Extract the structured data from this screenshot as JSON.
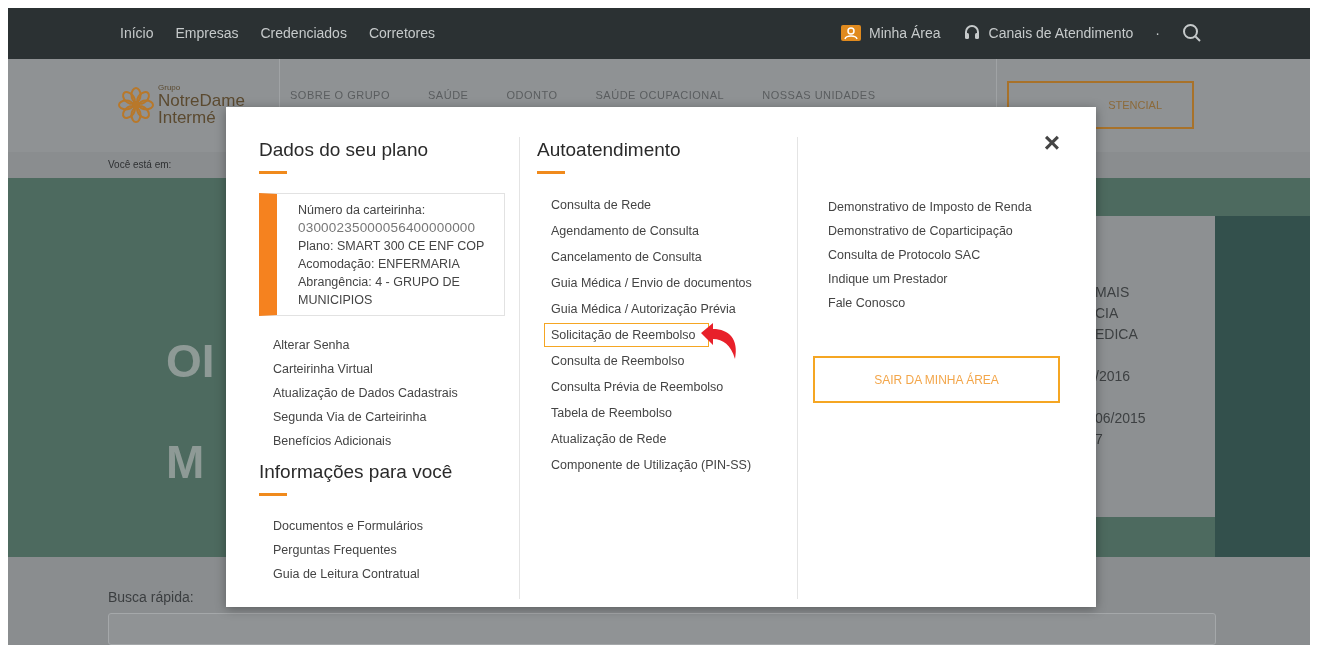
{
  "top_bar": {
    "nav": [
      "Início",
      "Empresas",
      "Credenciados",
      "Corretores"
    ],
    "my_area": "Minha Área",
    "support": "Canais de Atendimento",
    "separator": "·"
  },
  "header": {
    "logo": {
      "small": "Grupo",
      "line1": "NotreDame",
      "line2": "Intermé"
    },
    "nav": [
      "SOBRE O GRUPO",
      "SAÚDE",
      "ODONTO",
      "SAÚDE OCUPACIONAL",
      "NOSSAS UNIDADES"
    ],
    "button": "STENCIAL"
  },
  "breadcrumb": "Você está em:",
  "hero": {
    "big_lines": [
      "OI",
      "M"
    ],
    "card_lines": [
      "MAIS",
      "CIA",
      "EDICA",
      "/2016",
      "06/2015",
      "7"
    ]
  },
  "search": {
    "label": "Busca rápida:"
  },
  "modal": {
    "close": "×",
    "plan": {
      "title": "Dados do seu plano",
      "card": [
        {
          "label": "Número da carteirinha:"
        },
        {
          "value": "03000235000056400000000"
        },
        {
          "label": "Plano: SMART 300 CE ENF COP"
        },
        {
          "label": "Acomodação: ENFERMARIA"
        },
        {
          "label": "Abrangência: 4 - GRUPO DE MUNICIPIOS"
        }
      ],
      "links": [
        "Alterar Senha",
        "Carteirinha Virtual",
        "Atualização de Dados Cadastrais",
        "Segunda Via de Carteirinha",
        "Benefícios Adicionais"
      ]
    },
    "info": {
      "title": "Informações para você",
      "links": [
        "Documentos e Formulários",
        "Perguntas Frequentes",
        "Guia de Leitura Contratual"
      ]
    },
    "self_service": {
      "title": "Autoatendimento",
      "links": [
        {
          "label": "Consulta de Rede",
          "highlighted": false
        },
        {
          "label": "Agendamento de Consulta",
          "highlighted": false
        },
        {
          "label": "Cancelamento de Consulta",
          "highlighted": false
        },
        {
          "label": "Guia Médica / Envio de documentos",
          "highlighted": false
        },
        {
          "label": "Guia Médica / Autorização Prévia",
          "highlighted": false
        },
        {
          "label": "Solicitação de Reembolso",
          "highlighted": true
        },
        {
          "label": "Consulta de Reembolso",
          "highlighted": false
        },
        {
          "label": "Consulta Prévia de Reembolso",
          "highlighted": false
        },
        {
          "label": "Tabela de Reembolso",
          "highlighted": false
        },
        {
          "label": "Atualização de Rede",
          "highlighted": false
        },
        {
          "label": "Componente de Utilização (PIN-SS)",
          "highlighted": false
        }
      ]
    },
    "more_links": [
      "Demonstrativo de Imposto de Renda",
      "Demonstrativo de Coparticipação",
      "Consulta de Protocolo SAC",
      "Indique um Prestador",
      "Fale Conosco"
    ],
    "logout": "SAIR DA MINHA ÁREA"
  }
}
